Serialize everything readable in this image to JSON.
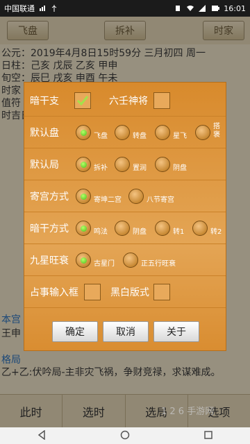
{
  "status_bar": {
    "carrier": "中国联通",
    "time": "16:01"
  },
  "toolbar": {
    "flying_plate": "飞盘",
    "chaibu": "拆补",
    "shijia": "时家"
  },
  "background_lines": [
    "公元：2019年4月8日15时59分 三月初四 周一",
    "日柱：己亥  戊辰  乙亥  甲申",
    "旬空：辰巳  戌亥  申酉  午未",
    "时家",
    "值符",
    "时吉日"
  ],
  "background_lower": {
    "line1": "本宫",
    "line2": "王申",
    "line3": "格局",
    "line4": "乙+乙:伏吟局-主非灾飞祸，争财竞禄，求谋难成。"
  },
  "tabs": [
    "此时",
    "选时",
    "选局",
    "选项"
  ],
  "dialog": {
    "row1": {
      "label": "暗干支",
      "label2": "六壬神将"
    },
    "row2": {
      "label": "默认盘",
      "options": [
        "飞盘",
        "转盘",
        "星飞",
        "搭\n褒"
      ]
    },
    "row3": {
      "label": "默认局",
      "options": [
        "拆补",
        "置润",
        "阴盘"
      ]
    },
    "row4": {
      "label": "寄宫方式",
      "options": [
        "寄坤二宫",
        "八节寄宫"
      ]
    },
    "row5": {
      "label": "暗干方式",
      "options": [
        "鸣法",
        "阴盘",
        "转1",
        "转2"
      ]
    },
    "row6": {
      "label": "九星旺衰",
      "options": [
        "古星门",
        "正五行旺衰"
      ]
    },
    "row7": {
      "label": "占事输入框",
      "label2": "黑白版式"
    },
    "buttons": {
      "ok": "确定",
      "cancel": "取消",
      "about": "关于"
    }
  },
  "watermark": "1 2 6 手游网"
}
